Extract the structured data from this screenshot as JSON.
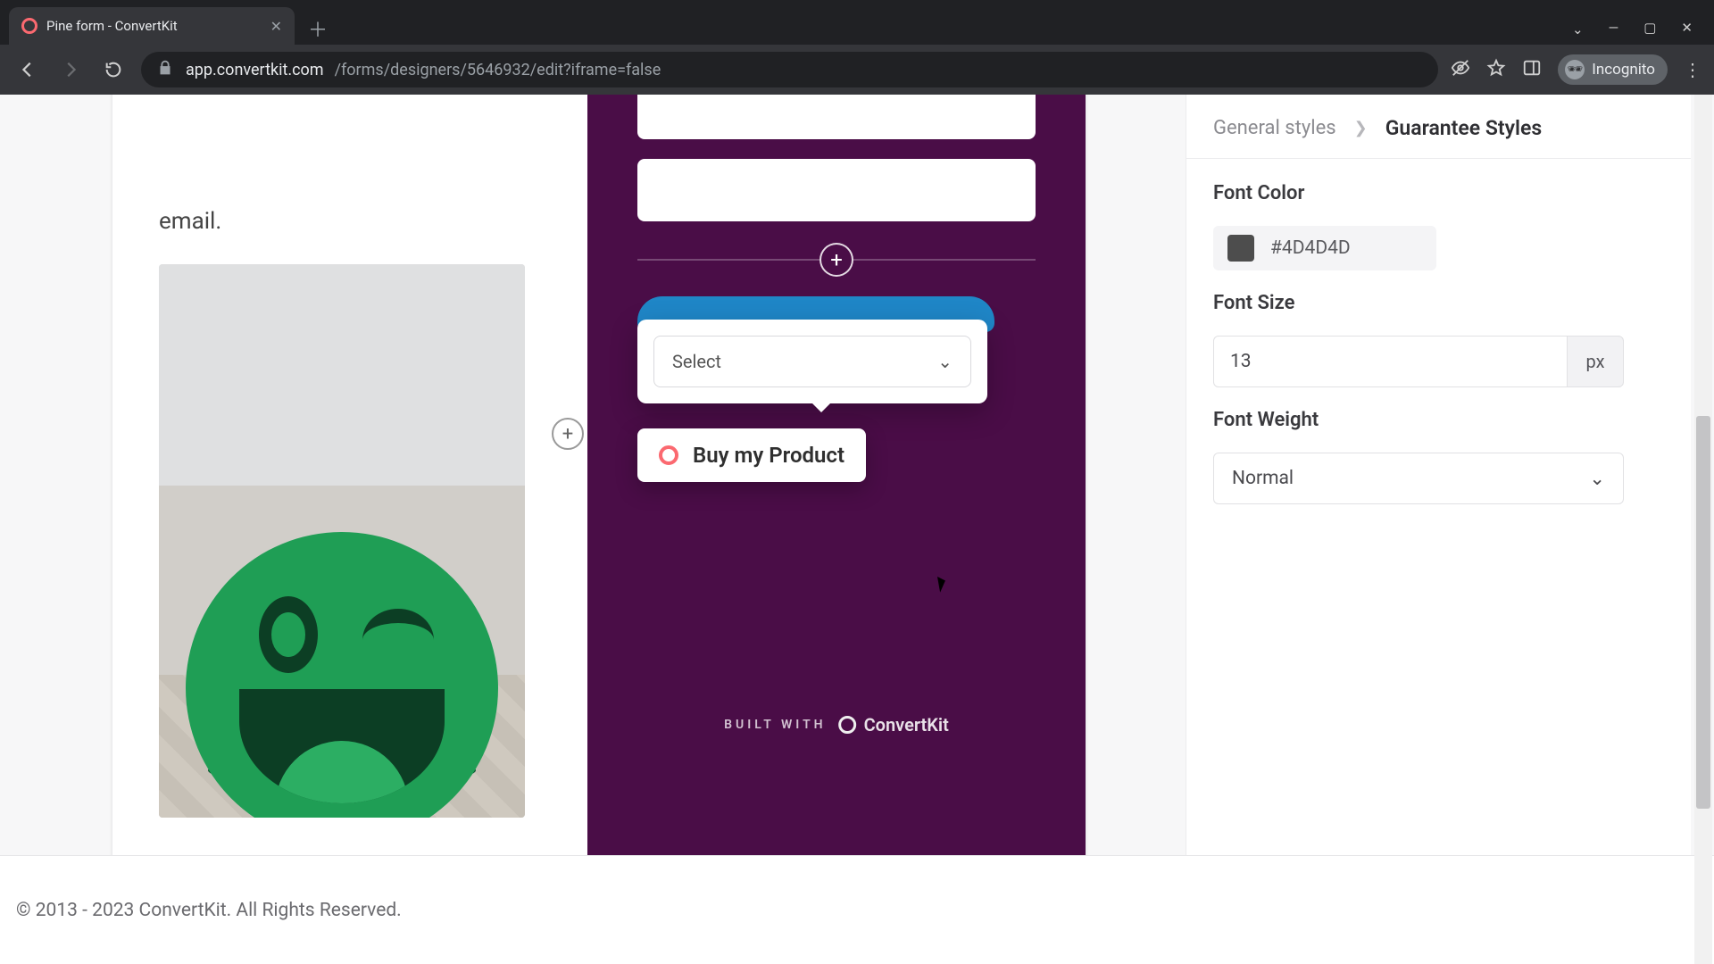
{
  "browser": {
    "tab_title": "Pine form - ConvertKit",
    "url_host": "app.convertkit.com",
    "url_path": "/forms/designers/5646932/edit?iframe=false",
    "incognito_label": "Incognito"
  },
  "canvas": {
    "intro_fragment": "email.",
    "select_placeholder": "Select",
    "buy_label": "Buy my Product",
    "built_with": "BUILT WITH",
    "brand": "ConvertKit"
  },
  "sidebar": {
    "crumb_root": "General styles",
    "crumb_leaf": "Guarantee Styles",
    "font_color_label": "Font Color",
    "font_color_hex": "#4D4D4D",
    "font_size_label": "Font Size",
    "font_size_value": "13",
    "font_size_unit": "px",
    "font_weight_label": "Font Weight",
    "font_weight_value": "Normal"
  },
  "footer": {
    "copyright": "© 2013 - 2023 ConvertKit. All Rights Reserved."
  }
}
